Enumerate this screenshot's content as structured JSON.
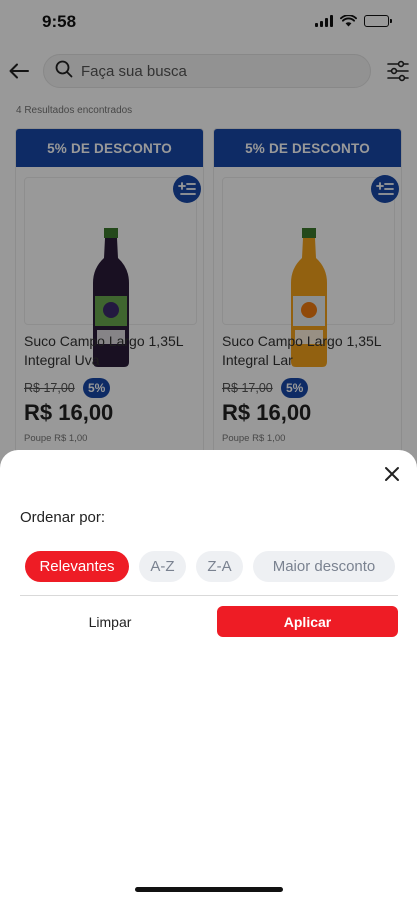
{
  "status_bar": {
    "time": "9:58"
  },
  "search": {
    "placeholder": "Faça sua busca"
  },
  "results": {
    "count_text": "4 Resultados encontrados"
  },
  "colors": {
    "brand_blue": "#1849a9",
    "brand_red": "#ee1c25"
  },
  "icons": [
    "back-arrow-icon",
    "search-icon",
    "filter-sliders-icon",
    "add-to-list-icon",
    "close-icon",
    "signal-icon",
    "wifi-icon",
    "battery-icon"
  ],
  "products": [
    {
      "banner": "5% DE DESCONTO",
      "name": "Suco Campo Largo 1,35L Integral Uva",
      "old_price": "R$ 17,00",
      "discount": "5%",
      "price": "R$ 16,00",
      "economy": "Poupe R$ 1,00",
      "bottle_color": "#2a1c3a",
      "label_color": "#6aa84f"
    },
    {
      "banner": "5% DE DESCONTO",
      "name": "Suco Campo Largo 1,35L Integral Lar",
      "old_price": "R$ 17,00",
      "discount": "5%",
      "price": "R$ 16,00",
      "economy": "Poupe R$ 1,00",
      "bottle_color": "#f4a21b",
      "label_color": "#e8eef2"
    }
  ],
  "sort_sheet": {
    "title": "Ordenar por:",
    "options": [
      "Relevantes",
      "A-Z",
      "Z-A",
      "Maior desconto"
    ],
    "selected": "Relevantes",
    "clear_label": "Limpar",
    "apply_label": "Aplicar"
  }
}
